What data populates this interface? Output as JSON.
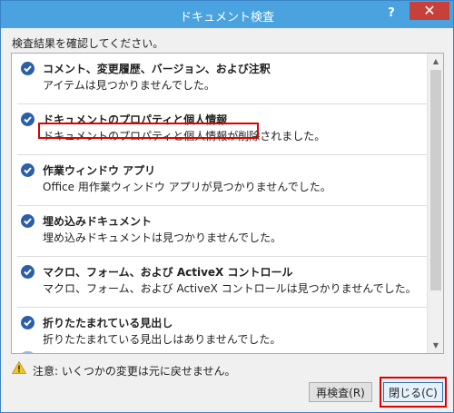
{
  "dialog": {
    "title": "ドキュメント検査",
    "help_label": "?",
    "close_label": "✕"
  },
  "instruction": "検査結果を確認してください。",
  "items": [
    {
      "title": "コメント、変更履歴、バージョン、および注釈",
      "detail": "アイテムは見つかりませんでした。"
    },
    {
      "title": "ドキュメントのプロパティと個人情報",
      "detail": "ドキュメントのプロパティと個人情報が削除されました。"
    },
    {
      "title": "作業ウィンドウ アプリ",
      "detail": "Office 用作業ウィンドウ アプリが見つかりませんでした。"
    },
    {
      "title": "埋め込みドキュメント",
      "detail": "埋め込みドキュメントは見つかりませんでした。"
    },
    {
      "title": "マクロ、フォーム、および ActiveX コントロール",
      "detail": "マクロ、フォーム、および ActiveX コントロールは見つかりませんでした。"
    },
    {
      "title": "折りたたまれている見出し",
      "detail": "折りたたまれている見出しはありませんでした。"
    }
  ],
  "warning": "注意: いくつかの変更は元に戻せません。",
  "buttons": {
    "recheck": "再検査(R)",
    "close": "閉じる(C)"
  },
  "colors": {
    "titlebar": "#4aa3df",
    "close_button": "#c7413a",
    "check_icon": "#2b5fa8",
    "highlight": "#e00000"
  }
}
